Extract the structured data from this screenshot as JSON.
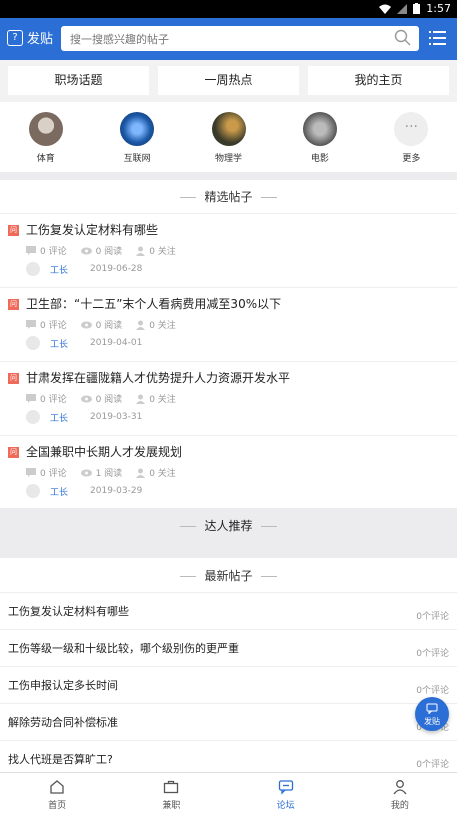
{
  "status": {
    "time": "1:57"
  },
  "header": {
    "post_label": "发贴",
    "search_placeholder": "搜一搜感兴趣的帖子"
  },
  "tabs": [
    "职场话题",
    "一周热点",
    "我的主页"
  ],
  "categories": [
    {
      "label": "体育",
      "color": "#7a6a60"
    },
    {
      "label": "互联网",
      "color": "#1d5aa8"
    },
    {
      "label": "物理学",
      "color": "#3a3a2a"
    },
    {
      "label": "电影",
      "color": "#555555"
    },
    {
      "label": "更多",
      "color": "#eeeeee"
    }
  ],
  "featured_title": "精选帖子",
  "featured_posts": [
    {
      "badge": "问",
      "title": "工伤复发认定材料有哪些",
      "comments": "0 评论",
      "reads": "0 阅读",
      "follows": "0 关注",
      "author": "工长",
      "date": "2019-06-28"
    },
    {
      "badge": "问",
      "title": "卫生部：“十二五”末个人看病费用减至30%以下",
      "comments": "0 评论",
      "reads": "0 阅读",
      "follows": "0 关注",
      "author": "工长",
      "date": "2019-04-01"
    },
    {
      "badge": "问",
      "title": "甘肃发挥在疆陇籍人才优势提升人力资源开发水平",
      "comments": "0 评论",
      "reads": "0 阅读",
      "follows": "0 关注",
      "author": "工长",
      "date": "2019-03-31"
    },
    {
      "badge": "问",
      "title": "全国兼职中长期人才发展规划",
      "comments": "0 评论",
      "reads": "1 阅读",
      "follows": "0 关注",
      "author": "工长",
      "date": "2019-03-29"
    }
  ],
  "expert_title": "达人推荐",
  "latest_title": "最新帖子",
  "latest_posts": [
    {
      "title": "工伤复发认定材料有哪些",
      "count": "0个评论"
    },
    {
      "title": "工伤等级一级和十级比较，哪个级别伤的更严重",
      "count": "0个评论"
    },
    {
      "title": "工伤申报认定多长时间",
      "count": "0个评论"
    },
    {
      "title": "解除劳动合同补偿标准",
      "count": "0个评论"
    },
    {
      "title": "找人代班是否算旷工?",
      "count": "0个评论"
    }
  ],
  "fab_label": "发贴",
  "bottom_nav": [
    {
      "label": "首页",
      "icon": "home-icon"
    },
    {
      "label": "兼职",
      "icon": "briefcase-icon"
    },
    {
      "label": "论坛",
      "icon": "forum-icon",
      "active": true
    },
    {
      "label": "我的",
      "icon": "person-icon"
    }
  ]
}
